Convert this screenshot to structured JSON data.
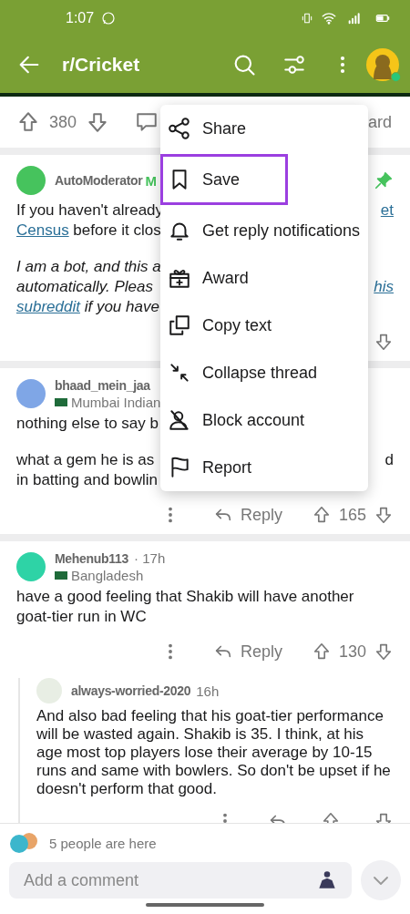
{
  "status_bar": {
    "time": "1:07"
  },
  "app_bar": {
    "title": "r/Cricket"
  },
  "post_actions": {
    "score": "380",
    "award_fragment": "ard"
  },
  "comments": [
    {
      "author": "AutoModerator",
      "flair_fragment": "M",
      "pinned": true,
      "paragraphs": [
        {
          "italic": false,
          "lines": [
            {
              "left": [
                {
                  "text": "If you haven't already",
                  "link": false
                }
              ],
              "right": [
                {
                  "text": "et",
                  "link": true
                }
              ]
            },
            {
              "left": [
                {
                  "text": "Census",
                  "link": true
                },
                {
                  "text": " before it clos",
                  "link": false
                }
              ]
            }
          ]
        },
        {
          "italic": true,
          "lines": [
            {
              "left": [
                {
                  "text": "I am a bot, and this a",
                  "link": false
                }
              ]
            },
            {
              "left": [
                {
                  "text": "automatically. Pleas",
                  "link": false
                }
              ],
              "right": [
                {
                  "text": "his",
                  "link": true
                }
              ]
            },
            {
              "left": [
                {
                  "text": "subreddit",
                  "link": true
                },
                {
                  "text": " if you have",
                  "link": false
                }
              ]
            }
          ]
        }
      ],
      "actions": {
        "kind": "partial"
      }
    },
    {
      "author": "bhaad_mein_jaa",
      "flair": "Mumbai Indian",
      "pinned": false,
      "paragraphs": [
        {
          "italic": false,
          "lines": [
            {
              "left": [
                {
                  "text": "nothing else to say b",
                  "link": false
                }
              ]
            }
          ]
        },
        {
          "italic": false,
          "lines": [
            {
              "left": [
                {
                  "text": "what a gem he is as",
                  "link": false
                }
              ],
              "right": [
                {
                  "text": "d",
                  "link": false
                }
              ]
            },
            {
              "left": [
                {
                  "text": "in batting and bowlin",
                  "link": false
                }
              ]
            }
          ]
        }
      ],
      "actions": {
        "kind": "full",
        "reply": "Reply",
        "score": "165"
      }
    },
    {
      "author": "Mehenub113",
      "age": "· 17h",
      "flair": "Bangladesh",
      "pinned": false,
      "paragraphs": [
        {
          "italic": false,
          "lines": [
            {
              "left": [
                {
                  "text": "have a good feeling that Shakib will have another",
                  "link": false
                }
              ]
            },
            {
              "left": [
                {
                  "text": "goat-tier run in WC",
                  "link": false
                }
              ]
            }
          ]
        }
      ],
      "actions": {
        "kind": "full",
        "reply": "Reply",
        "score": "130"
      },
      "replies": [
        {
          "author": "always-worried-2020",
          "age": "16h",
          "text": "And also bad feeling that his goat-tier performance will be wasted again. Shakib is 35. I think, at his age most top players lose their average by 10-15 runs and same with bowlers. So don't be upset if he doesn't perform that good."
        }
      ]
    }
  ],
  "menu": {
    "items": [
      {
        "kind": "share",
        "label": "Share",
        "highlighted": false
      },
      {
        "kind": "save",
        "label": "Save",
        "highlighted": true
      },
      {
        "kind": "bell",
        "label": "Get reply notifications",
        "highlighted": false
      },
      {
        "kind": "award",
        "label": "Award",
        "highlighted": false
      },
      {
        "kind": "copy",
        "label": "Copy text",
        "highlighted": false
      },
      {
        "kind": "collapse",
        "label": "Collapse thread",
        "highlighted": false
      },
      {
        "kind": "block",
        "label": "Block account",
        "highlighted": false
      },
      {
        "kind": "report",
        "label": "Report",
        "highlighted": false
      }
    ]
  },
  "footer": {
    "presence": "5 people are here",
    "comment_placeholder": "Add a comment"
  }
}
